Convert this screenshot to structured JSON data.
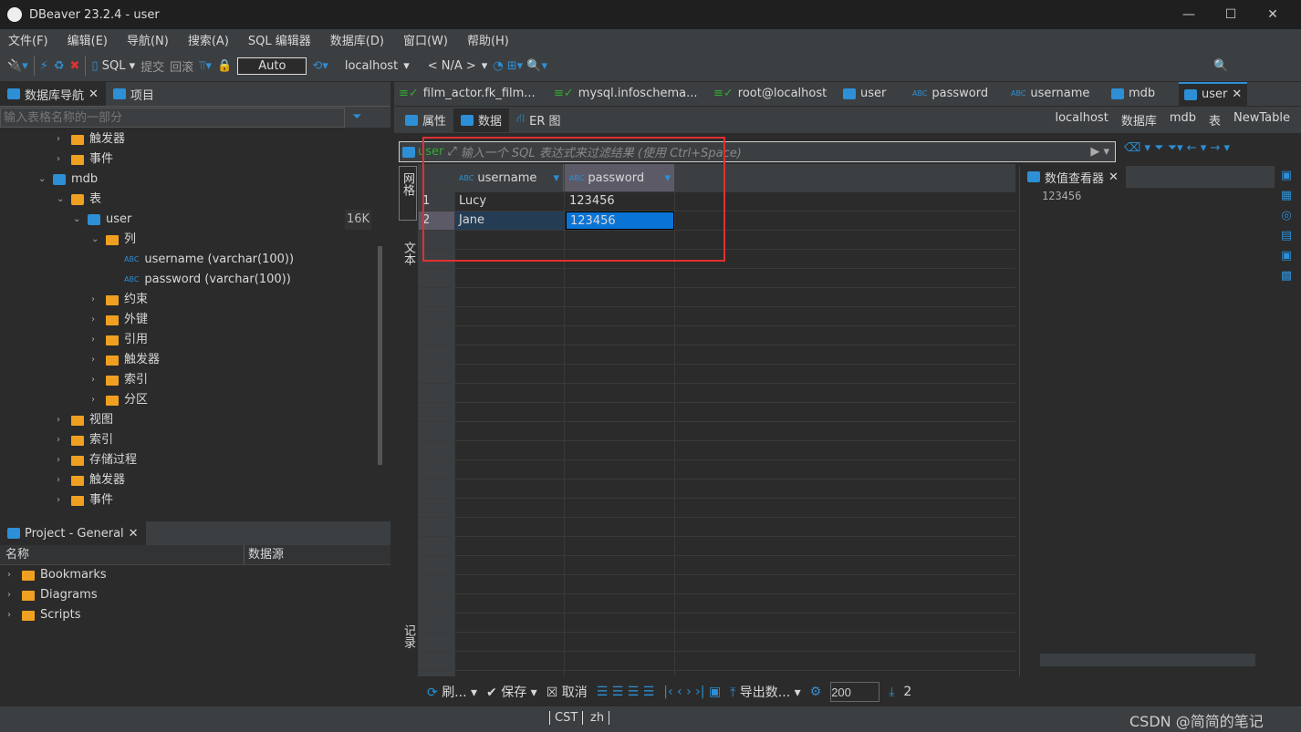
{
  "window": {
    "title": "DBeaver 23.2.4 - user",
    "minimize": "—",
    "maximize": "☐",
    "close": "✕"
  },
  "menu": [
    "文件(F)",
    "编辑(E)",
    "导航(N)",
    "搜索(A)",
    "SQL 编辑器",
    "数据库(D)",
    "窗口(W)",
    "帮助(H)"
  ],
  "toolbar": {
    "sql": "SQL",
    "commit": "提交",
    "rollback": "回滚",
    "mode": "Auto",
    "datasource": "localhost",
    "schema": "< N/A >"
  },
  "nav": {
    "tab_nav": "数据库导航",
    "tab_project": "项目",
    "filter_placeholder": "输入表格名称的一部分",
    "tree": [
      {
        "label": "触发器",
        "indent": 1,
        "type": "folder",
        "arrow": "›"
      },
      {
        "label": "事件",
        "indent": 1,
        "type": "folder",
        "arrow": "›"
      },
      {
        "label": "mdb",
        "indent": 0,
        "type": "db",
        "arrow": "⌄"
      },
      {
        "label": "表",
        "indent": 1,
        "type": "table-folder",
        "arrow": "⌄"
      },
      {
        "label": "user",
        "indent": 2,
        "type": "table",
        "arrow": "⌄",
        "size": "16K"
      },
      {
        "label": "列",
        "indent": 3,
        "type": "folder",
        "arrow": "⌄"
      },
      {
        "label": "username (varchar(100))",
        "indent": 4,
        "type": "column",
        "arrow": ""
      },
      {
        "label": "password (varchar(100))",
        "indent": 4,
        "type": "column",
        "arrow": ""
      },
      {
        "label": "约束",
        "indent": 3,
        "type": "folder",
        "arrow": "›"
      },
      {
        "label": "外键",
        "indent": 3,
        "type": "folder",
        "arrow": "›"
      },
      {
        "label": "引用",
        "indent": 3,
        "type": "folder",
        "arrow": "›"
      },
      {
        "label": "触发器",
        "indent": 3,
        "type": "folder",
        "arrow": "›"
      },
      {
        "label": "索引",
        "indent": 3,
        "type": "folder",
        "arrow": "›"
      },
      {
        "label": "分区",
        "indent": 3,
        "type": "folder",
        "arrow": "›"
      },
      {
        "label": "视图",
        "indent": 1,
        "type": "folder",
        "arrow": "›"
      },
      {
        "label": "索引",
        "indent": 1,
        "type": "folder",
        "arrow": "›"
      },
      {
        "label": "存储过程",
        "indent": 1,
        "type": "folder",
        "arrow": "›"
      },
      {
        "label": "触发器",
        "indent": 1,
        "type": "folder",
        "arrow": "›"
      },
      {
        "label": "事件",
        "indent": 1,
        "type": "folder",
        "arrow": "›"
      }
    ]
  },
  "project": {
    "tab": "Project - General",
    "col_name": "名称",
    "col_source": "数据源",
    "items": [
      "Bookmarks",
      "Diagrams",
      "Scripts"
    ]
  },
  "editor": {
    "tabs": [
      "film_actor.fk_film...",
      "mysql.infoschema...",
      "root@localhost",
      "user",
      "password",
      "username",
      "mdb",
      "user"
    ],
    "subtabs": [
      "属性",
      "数据",
      "ER 图"
    ],
    "breadcrumbs": [
      "localhost",
      "数据库",
      "mdb",
      "表",
      "NewTable"
    ],
    "filter_entity": "user",
    "filter_placeholder": "输入一个 SQL 表达式来过滤结果 (使用 Ctrl+Space)",
    "side_tabs": [
      "网格",
      "文本",
      "记录"
    ],
    "columns": [
      "username",
      "password"
    ],
    "rows": [
      [
        "1",
        "Lucy",
        "123456"
      ],
      [
        "2",
        "Jane",
        "123456"
      ]
    ],
    "viewer_title": "数值查看器",
    "viewer_value": "123456",
    "bottom": {
      "refresh": "刷...",
      "save": "保存",
      "cancel": "取消",
      "export": "导出数...",
      "fetch_size": "200",
      "row_count": "2"
    }
  },
  "status": {
    "tz": "CST",
    "locale": "zh"
  },
  "watermark": "CSDN @简简的笔记"
}
